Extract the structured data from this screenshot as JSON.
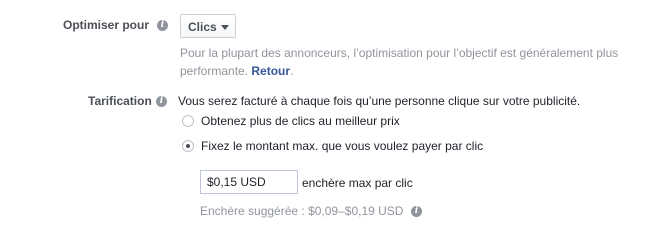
{
  "optimize": {
    "label": "Optimiser pour",
    "info_icon": "info-icon",
    "dropdown_value": "Clics",
    "help_text": "Pour la plupart des annonceurs, l’optimisation pour l’objectif est généralement plus performante.",
    "help_link": "Retour"
  },
  "pricing": {
    "label": "Tarification",
    "info_icon": "info-icon",
    "description": "Vous serez facturé à chaque fois qu’une personne clique sur votre publicité.",
    "options": [
      {
        "label": "Obtenez plus de clics au meilleur prix",
        "selected": false
      },
      {
        "label": "Fixez le montant max. que vous voulez payer par clic",
        "selected": true
      }
    ],
    "bid_value": "$0,15 USD",
    "bid_suffix": "enchère max par clic",
    "suggested": "Enchère suggérée : $0,09–$0,19 USD"
  }
}
